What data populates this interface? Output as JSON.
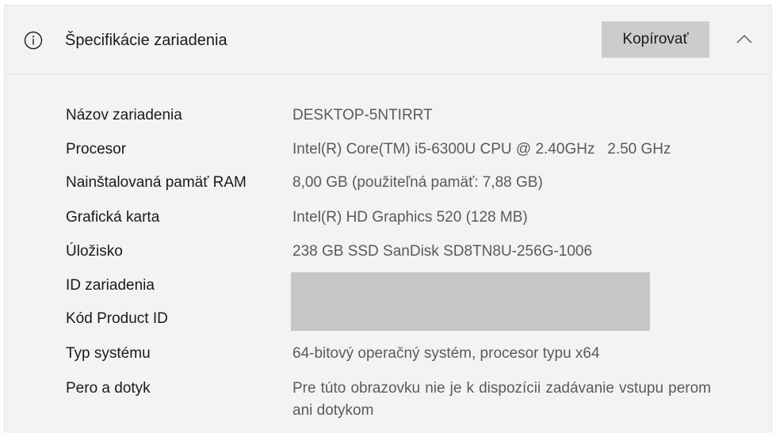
{
  "header": {
    "title": "Špecifikácie zariadenia",
    "copy_label": "Kopírovať",
    "icons": {
      "info": "info-circle-icon",
      "collapse": "chevron-up-icon"
    }
  },
  "specs": [
    {
      "label": "Názov zariadenia",
      "value": "DESKTOP-5NTIRRT"
    },
    {
      "label": "Procesor",
      "value": "Intel(R) Core(TM) i5-6300U CPU @ 2.40GHz   2.50 GHz"
    },
    {
      "label": "Nainštalovaná pamäť RAM",
      "value": "8,00 GB (použiteľná pamäť: 7,88 GB)"
    },
    {
      "label": "Grafická karta",
      "value": "Intel(R) HD Graphics 520 (128 MB)"
    },
    {
      "label": "Úložisko",
      "value": "238 GB SSD SanDisk SD8TN8U-256G-1006"
    },
    {
      "label": "ID zariadenia",
      "value": ""
    },
    {
      "label": "Kód Product ID",
      "value": ""
    },
    {
      "label": "Typ systému",
      "value": "64-bitový operačný systém, procesor typu x64"
    },
    {
      "label": "Pero a dotyk",
      "value": "Pre túto obrazovku nie je k dispozícii zadávanie vstupu perom ani dotykom"
    }
  ],
  "colors": {
    "panel_bg": "#f3f3f3",
    "button_bg": "#cccccc",
    "redaction": "#c6c6c6",
    "label_text": "#1a1a1a",
    "value_text": "#5a5a5a"
  }
}
